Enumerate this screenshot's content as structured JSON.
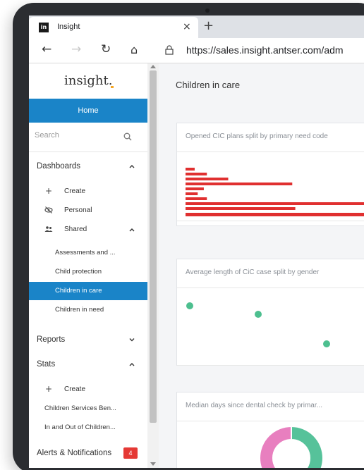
{
  "browser": {
    "tab_title": "Insight",
    "favicon_text": "in",
    "url": "https://sales.insight.antser.com/adm"
  },
  "sidebar": {
    "logo": "insight.",
    "home_label": "Home",
    "search_placeholder": "Search",
    "dashboards_label": "Dashboards",
    "dashboard_items": [
      {
        "icon": "plus-icon",
        "label": "Create"
      },
      {
        "icon": "eye-off-icon",
        "label": "Personal"
      },
      {
        "icon": "users-icon",
        "label": "Shared"
      }
    ],
    "shared_items": [
      {
        "label": "Assessments and ..."
      },
      {
        "label": "Child protection"
      },
      {
        "label": "Children in care",
        "active": true
      },
      {
        "label": "Children in need"
      }
    ],
    "reports_label": "Reports",
    "stats_label": "Stats",
    "stats_items": [
      {
        "label": "Create"
      },
      {
        "label": "Children Services Ben..."
      },
      {
        "label": "In and Out of Children..."
      }
    ],
    "alerts_label": "Alerts & Notifications",
    "alerts_count": "4"
  },
  "main": {
    "page_title": "Children in care",
    "cards": [
      {
        "title": "Opened CIC plans split by primary need code"
      },
      {
        "title": "Average length of CiC case split by gender"
      },
      {
        "title": "Median days since dental check by primar..."
      }
    ]
  },
  "chart_data": [
    {
      "type": "bar",
      "orientation": "horizontal",
      "values": [
        3,
        7,
        14,
        35,
        6,
        4,
        7,
        60,
        36,
        62
      ],
      "color": "#e03030"
    },
    {
      "type": "scatter",
      "x": [
        1,
        2,
        3
      ],
      "y": [
        3,
        2.8,
        2.1
      ],
      "color": "#4dbf8f"
    },
    {
      "type": "pie",
      "values": [
        50,
        50
      ],
      "colors": [
        "#56c29a",
        "#e87fbf"
      ]
    }
  ],
  "colors": {
    "accent": "#1a84c8",
    "bar": "#e03030",
    "scatter": "#4dbf8f"
  }
}
